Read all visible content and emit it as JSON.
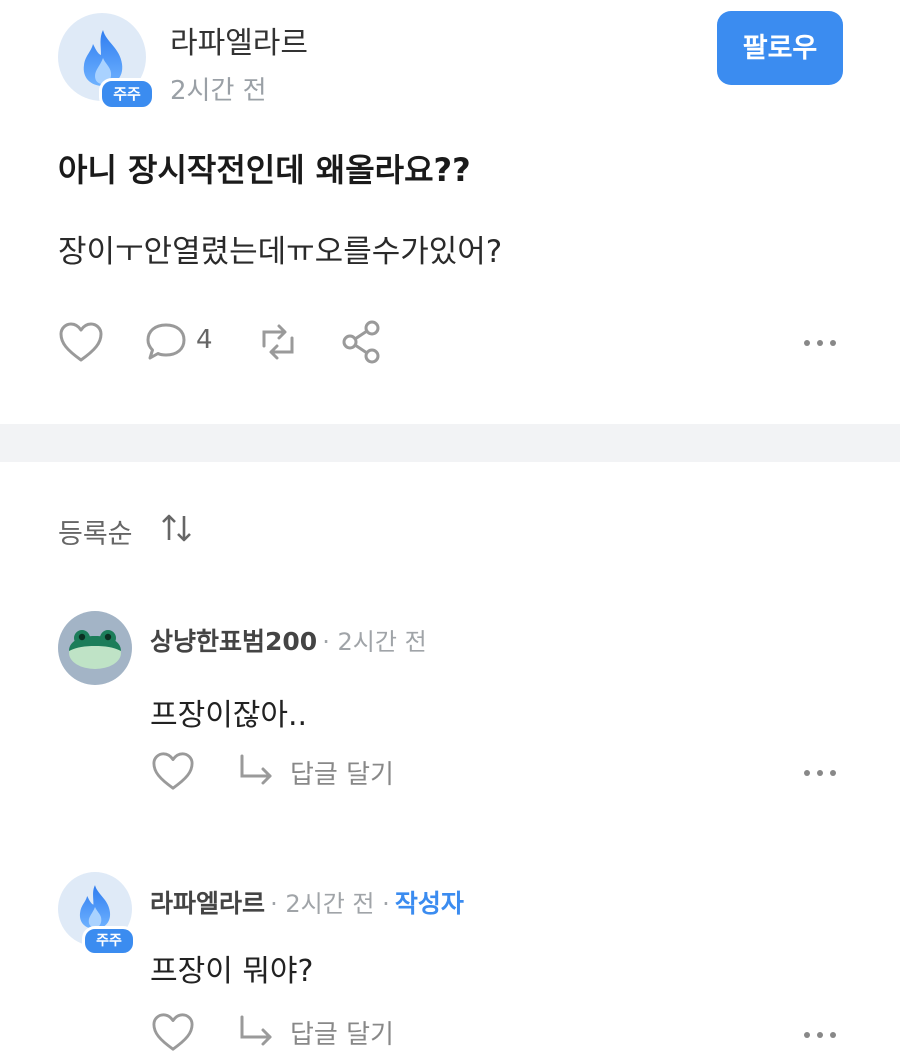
{
  "post": {
    "author": "라파엘라르",
    "badge": "주주",
    "time": "2시간 전",
    "follow_label": "팔로우",
    "title": "아니 장시작전인데 왜올라요??",
    "body": "장이ㅜ안열렸는데ㅠ오를수가있어?",
    "comment_count": "4",
    "icons": [
      "heart-icon",
      "comment-icon",
      "repost-icon",
      "share-icon",
      "more-icon"
    ]
  },
  "sort": {
    "label": "등록순",
    "icon": "sort-arrows-icon"
  },
  "comments": [
    {
      "author": "상냥한표범200",
      "time": "· 2시간 전",
      "text": "프장이잖아..",
      "reply_label": "답글 달기",
      "avatar": "frog-avatar"
    },
    {
      "author": "라파엘라르",
      "time": "· 2시간 전 ·",
      "author_tag": "작성자",
      "badge": "주주",
      "text": "프장이 뭐야?",
      "reply_label": "답글 달기",
      "avatar": "flame-avatar"
    }
  ],
  "colors": {
    "accent": "#3b8cf0",
    "divider": "#f2f3f5",
    "muted": "#9aa0a6"
  }
}
